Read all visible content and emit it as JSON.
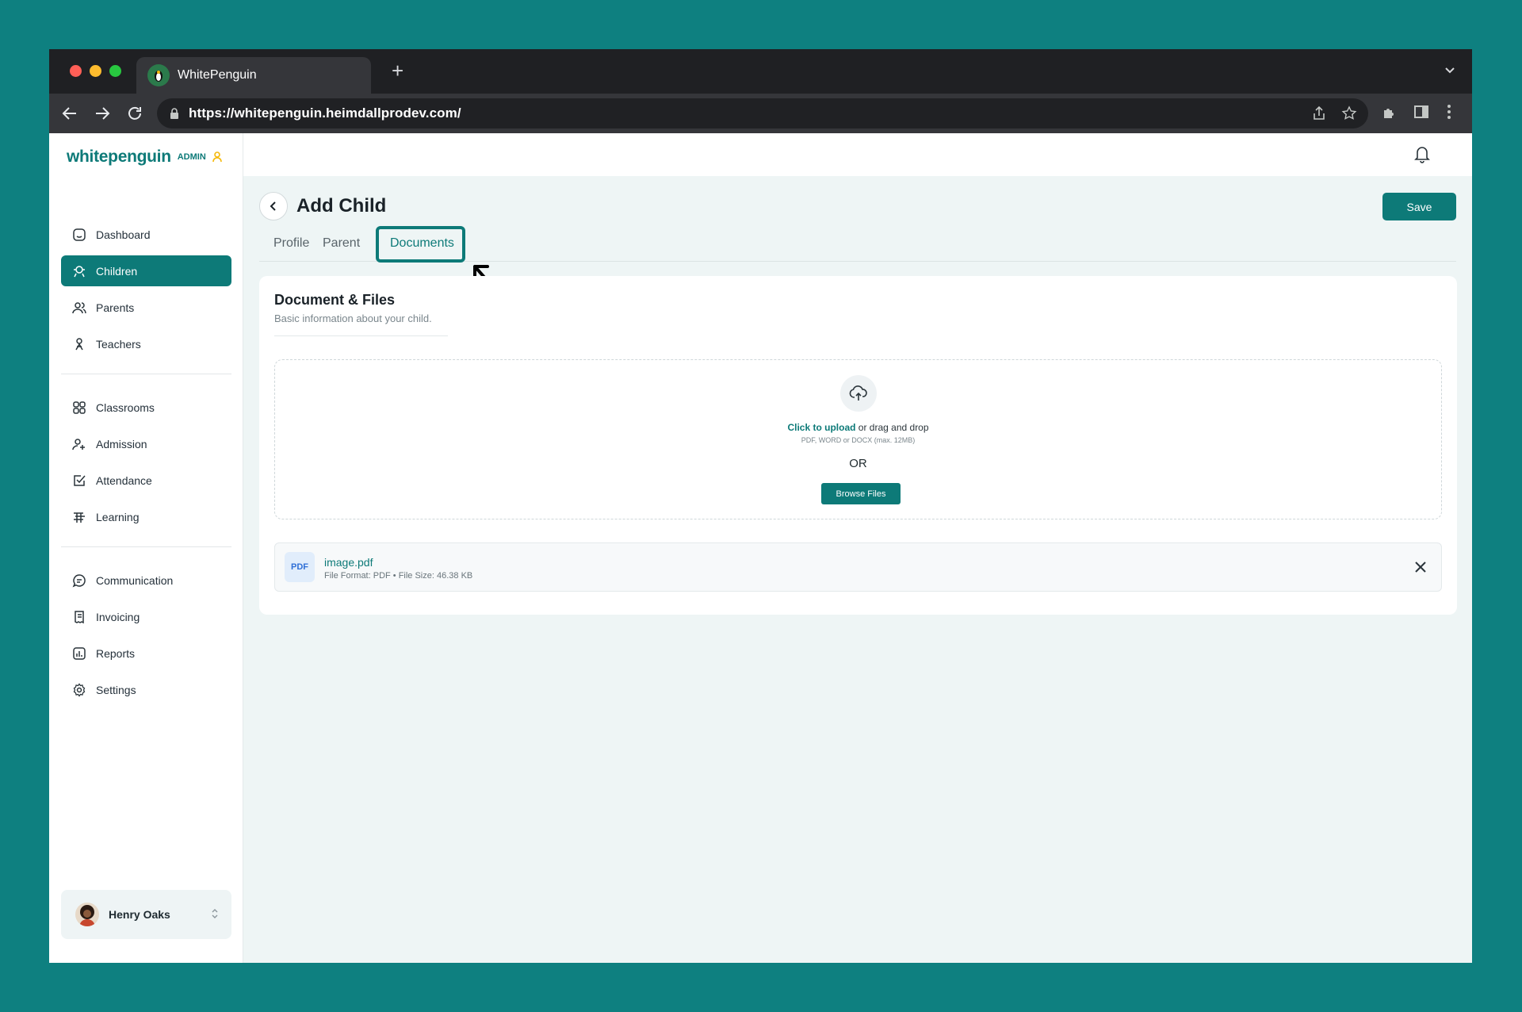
{
  "browser": {
    "tab_title": "WhitePenguin",
    "url": "https://whitepenguin.heimdallprodev.com/"
  },
  "brand": {
    "name_main": "whitepenguin",
    "badge": "ADMIN"
  },
  "sidebar": {
    "items": [
      {
        "label": "Dashboard",
        "icon": "home-icon"
      },
      {
        "label": "Children",
        "icon": "child-icon",
        "active": true
      },
      {
        "label": "Parents",
        "icon": "users-icon"
      },
      {
        "label": "Teachers",
        "icon": "teacher-icon"
      },
      {
        "label": "Classrooms",
        "icon": "grid-icon"
      },
      {
        "label": "Admission",
        "icon": "user-add-icon"
      },
      {
        "label": "Attendance",
        "icon": "checkbox-icon"
      },
      {
        "label": "Learning",
        "icon": "book-icon"
      },
      {
        "label": "Communication",
        "icon": "chat-icon"
      },
      {
        "label": "Invoicing",
        "icon": "invoice-icon"
      },
      {
        "label": "Reports",
        "icon": "chart-icon"
      },
      {
        "label": "Settings",
        "icon": "gear-icon"
      }
    ],
    "user": {
      "name": "Henry Oaks"
    }
  },
  "page": {
    "title": "Add Child",
    "save_label": "Save",
    "tabs": [
      "Profile",
      "Parent",
      "Documents"
    ],
    "active_tab": "Documents"
  },
  "card": {
    "title": "Document & Files",
    "subtitle": "Basic information about your child.",
    "upload_link": "Click to upload",
    "upload_rest": " or drag and drop",
    "upload_hint": "PDF, WORD or DOCX (max. 12MB)",
    "or": "OR",
    "browse_label": "Browse Files"
  },
  "file": {
    "badge": "PDF",
    "name": "image.pdf",
    "meta": "File Format: PDF • File Size: 46.38 KB"
  },
  "colors": {
    "background": "#0e8080",
    "accent": "#0d7a78",
    "page_bg": "#eef5f5"
  }
}
